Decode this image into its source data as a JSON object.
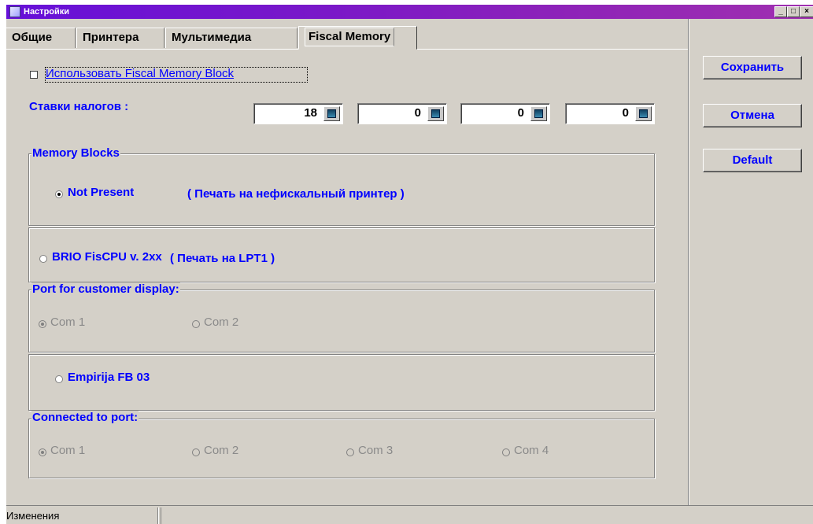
{
  "window": {
    "title": "Настройки",
    "accent": "#6610d8",
    "controls": {
      "minimize": "_",
      "maximize": "□",
      "close": "×"
    }
  },
  "tabs": [
    {
      "label": "Общие",
      "active": false
    },
    {
      "label": "Принтера",
      "active": false
    },
    {
      "label": "Мультимедиа",
      "active": false
    },
    {
      "label": "Fiscal Memory",
      "active": true
    }
  ],
  "fiscal": {
    "use_block_label": "Использовать Fiscal Memory Block",
    "use_block_checked": false,
    "tax_label": "Ставки налогов :",
    "tax_rates": [
      "18",
      "0",
      "0",
      "0"
    ]
  },
  "memory_blocks": {
    "title": "Memory Blocks",
    "not_present": {
      "label": "Not Present",
      "note": "( Печать на нефискальный принтер )",
      "selected": true
    },
    "brio": {
      "label": "BRIO FisCPU v. 2xx",
      "note": "( Печать на LPT1 )",
      "selected": false
    },
    "customer_display": {
      "title": "Port for customer display:",
      "options": [
        "Com 1",
        "Com 2"
      ],
      "selected": "Com 1",
      "enabled": false
    },
    "empirija": {
      "label": "Empirija FB 03",
      "selected": false
    },
    "connected_port": {
      "title": "Connected to port:",
      "options": [
        "Com 1",
        "Com 2",
        "Com 3",
        "Com 4"
      ],
      "selected": "Com 1",
      "enabled": false
    }
  },
  "buttons": {
    "save": "Сохранить",
    "cancel": "Отмена",
    "default": "Default"
  },
  "status": {
    "text": "Изменения"
  },
  "colors": {
    "label_blue": "#0000ff",
    "disabled_gray": "#8a8a8a",
    "face": "#d4d0c8"
  }
}
